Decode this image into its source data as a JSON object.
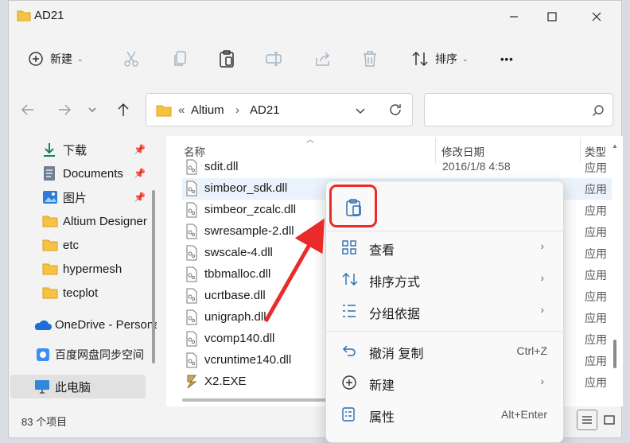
{
  "window": {
    "title": "AD21",
    "minimize_icon": "minimize-icon",
    "maximize_icon": "maximize-icon",
    "close_icon": "close-icon"
  },
  "toolbar": {
    "new_label": "新建",
    "sort_label": "排序",
    "more_label": "•••",
    "icons": [
      "add-circle-icon",
      "cut-icon",
      "copy-icon",
      "paste-icon",
      "rename-icon",
      "share-icon",
      "delete-icon",
      "sort-icon",
      "more-icon"
    ]
  },
  "address": {
    "overflow": "«",
    "crumbs": [
      "Altium",
      "AD21"
    ],
    "separator": "›"
  },
  "sidebar": {
    "items": [
      {
        "label": "下载",
        "icon": "download-icon",
        "pinned": true
      },
      {
        "label": "Documents",
        "icon": "documents-icon",
        "pinned": true
      },
      {
        "label": "图片",
        "icon": "pictures-icon",
        "pinned": true
      },
      {
        "label": "Altium Designer",
        "icon": "folder-icon",
        "pinned": false
      },
      {
        "label": "etc",
        "icon": "folder-icon",
        "pinned": false
      },
      {
        "label": "hypermesh",
        "icon": "folder-icon",
        "pinned": false
      },
      {
        "label": "tecplot",
        "icon": "folder-icon",
        "pinned": false
      },
      {
        "label": "OneDrive - Personal",
        "icon": "onedrive-icon",
        "pinned": false
      },
      {
        "label": "百度网盘同步空间",
        "icon": "baidu-netdisk-icon",
        "pinned": false
      },
      {
        "label": "此电脑",
        "icon": "this-pc-icon",
        "pinned": false,
        "selected": true
      }
    ]
  },
  "filelist": {
    "headers": {
      "name": "名称",
      "modified": "修改日期",
      "type": "类型"
    },
    "rows": [
      {
        "name": "sdit.dll",
        "modified": "2016/1/8 4:58",
        "type": "应用"
      },
      {
        "name": "simbeor_sdk.dll",
        "modified": "",
        "type": "应用"
      },
      {
        "name": "simbeor_zcalc.dll",
        "modified": "",
        "type": "应用"
      },
      {
        "name": "swresample-2.dll",
        "modified": "",
        "type": "应用"
      },
      {
        "name": "swscale-4.dll",
        "modified": "",
        "type": "应用"
      },
      {
        "name": "tbbmalloc.dll",
        "modified": "",
        "type": "应用"
      },
      {
        "name": "ucrtbase.dll",
        "modified": "",
        "type": "应用"
      },
      {
        "name": "unigraph.dll",
        "modified": "",
        "type": "应用"
      },
      {
        "name": "vcomp140.dll",
        "modified": "",
        "type": "应用"
      },
      {
        "name": "vcruntime140.dll",
        "modified": "",
        "type": "应用"
      },
      {
        "name": "X2.EXE",
        "modified": "",
        "type": "应用"
      }
    ]
  },
  "status": {
    "count": "83 个项目"
  },
  "context_menu": {
    "top_icon": "paste-icon",
    "items": [
      {
        "label": "查看",
        "icon": "view-icon",
        "shortcut": "",
        "submenu": true
      },
      {
        "label": "排序方式",
        "icon": "sort-icon",
        "shortcut": "",
        "submenu": true
      },
      {
        "label": "分组依据",
        "icon": "group-icon",
        "shortcut": "",
        "submenu": true
      },
      {
        "label": "撤消 复制",
        "icon": "undo-icon",
        "shortcut": "Ctrl+Z",
        "submenu": false
      },
      {
        "label": "新建",
        "icon": "add-circle-icon",
        "shortcut": "",
        "submenu": true
      },
      {
        "label": "属性",
        "icon": "properties-icon",
        "shortcut": "Alt+Enter",
        "submenu": false
      }
    ],
    "submenu_arrow": "›"
  },
  "annotation": {
    "highlight_color": "#ea2b2b"
  }
}
